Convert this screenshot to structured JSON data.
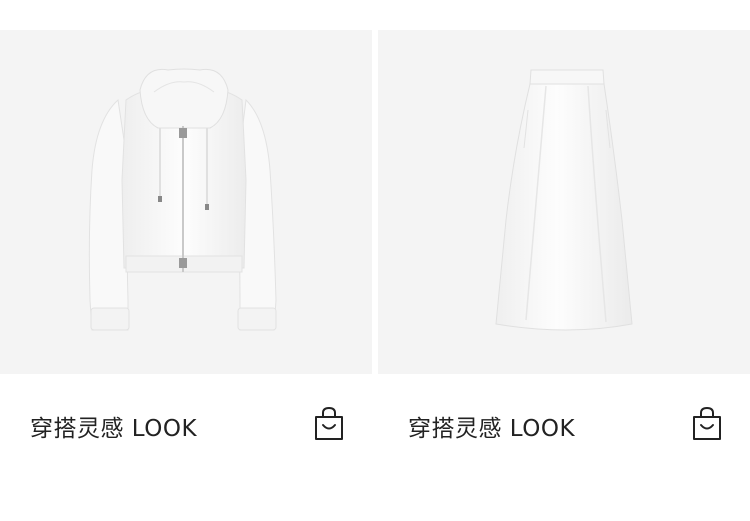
{
  "products": [
    {
      "caption": "穿搭灵感 LOOK",
      "image_subject": "white-zip-hoodie",
      "icon": "shopping-bag-icon"
    },
    {
      "caption": "穿搭灵感 LOOK",
      "image_subject": "white-maxi-skirt",
      "icon": "shopping-bag-icon"
    }
  ],
  "colors": {
    "image_background": "#f4f4f4",
    "text": "#222222",
    "garment": "#fbfbfb",
    "garment_shadow": "#e6e6e6"
  }
}
